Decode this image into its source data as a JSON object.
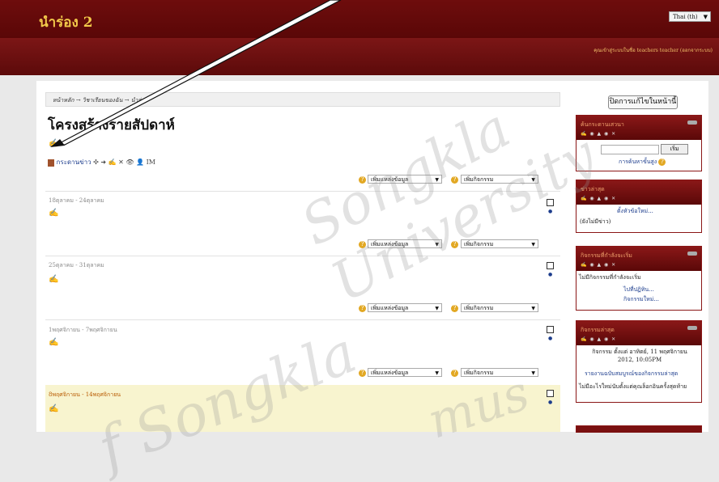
{
  "header": {
    "site_name": "นำร่อง 2",
    "language_select": "Thai (th)",
    "user_info": "คุณเข้าสู่ระบบในชื่อ teachers teacher (ออกจากระบบ)"
  },
  "breadcrumb": {
    "text": "หน้าหลัก → วิชาเรียนของฉัน → นำร่อง"
  },
  "turn_edit_off_button": "ปิดการแก้ไขในหน้านี้",
  "page_title": "โครงสร้างรายสัปดาห์",
  "edit_icon": "✍",
  "news_forum": {
    "label": "กระดานข่าว",
    "tools": "✣ ➜ ✍ ✕ 👁 👤 IM"
  },
  "add_controls": {
    "add_resource": "เพิ่มแหล่งข้อมูล",
    "add_activity": "เพิ่มกิจกรรม"
  },
  "weeks": [
    {
      "title": "18ตุลาคม - 24ตุลาคม"
    },
    {
      "title": "25ตุลาคม - 31ตุลาคม"
    },
    {
      "title": "1พฤศจิกายน - 7พฤศจิกายน"
    },
    {
      "title": "8พฤศจิกายน - 14พฤศจิกายน"
    }
  ],
  "blocks": {
    "search": {
      "title": "ค้นกระดานเสวนา",
      "button": "เริ่ม",
      "advanced": "การค้นหาขั้นสูง"
    },
    "latest_news": {
      "title": "ข่าวล่าสุด",
      "add_topic": "ตั้งหัวข้อใหม่...",
      "empty": "(ยังไม่มีข่าว)"
    },
    "upcoming": {
      "title": "กิจกรรมที่กำลังจะเริ่ม",
      "empty": "ไม่มีกิจกรรมที่กำลังจะเริ่ม",
      "calendar_link": "ไปที่ปฏิทิน...",
      "new_event": "กิจกรรมใหม่..."
    },
    "recent": {
      "title": "กิจกรรมล่าสุด",
      "since": "กิจกรรม ตั้งแต่ อาทิตย์, 11 พฤศจิกายน 2012, 10:05PM",
      "full_report": "รายงานฉบับสมบูรณ์ของกิจกรรมล่าสุด",
      "nothing": "ไม่มีอะไรใหม่นับตั้งแต่คุณล็อกอินครั้งสุดท้าย"
    }
  },
  "watermark": {
    "line1": "Songkla University",
    "line2": "f Songkla",
    "line3": "mus"
  }
}
